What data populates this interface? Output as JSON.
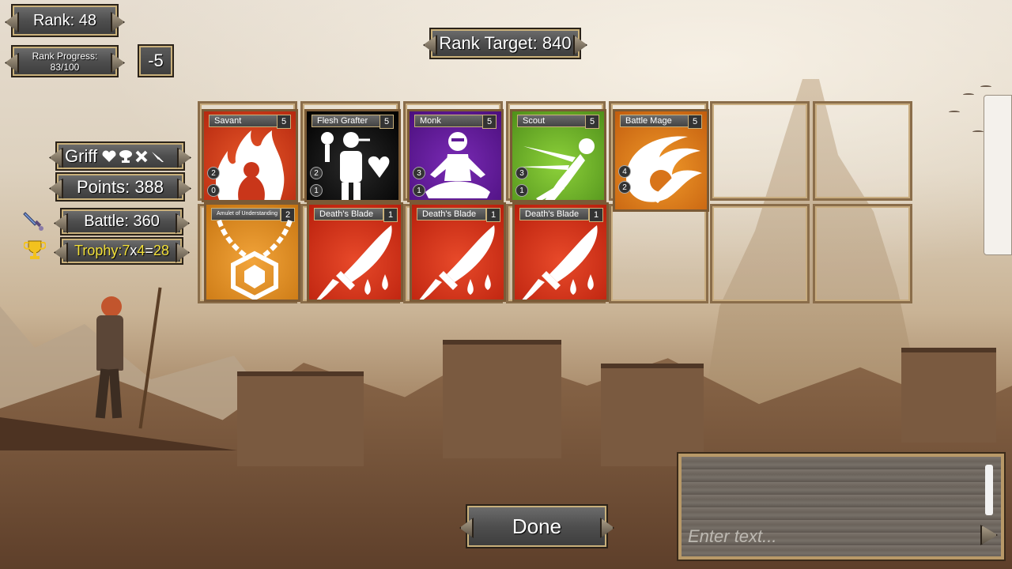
{
  "hud": {
    "rank": "Rank: 48",
    "rank_progress_label": "Rank Progress:",
    "rank_progress_value": "83/100",
    "rank_delta": "-5",
    "rank_target": "Rank Target: 840"
  },
  "player": {
    "name": "Griff",
    "icons": [
      "heart-icon",
      "mushroom-cloud-icon",
      "cross-icon",
      "dagger-icon"
    ],
    "points": "Points: 388",
    "battle": "Battle: 360",
    "trophy_label": "Trophy: ",
    "trophy_a": "7",
    "trophy_x": "x",
    "trophy_b": "4",
    "trophy_eq": "=",
    "trophy_total": "28"
  },
  "heroes": [
    {
      "name": "Savant",
      "level": "5",
      "stats": [
        "2",
        "0"
      ],
      "color": "#c9361a",
      "icon": "fire-person-icon"
    },
    {
      "name": "Flesh Grafter",
      "level": "5",
      "stats": [
        "2",
        "1"
      ],
      "color": "#111111",
      "icon": "flesh-grafter-icon"
    },
    {
      "name": "Monk",
      "level": "5",
      "stats": [
        "3",
        "1"
      ],
      "color": "#5e1a95",
      "icon": "meditating-monk-icon"
    },
    {
      "name": "Scout",
      "level": "5",
      "stats": [
        "3",
        "1"
      ],
      "color": "#6aae25",
      "icon": "running-scout-icon"
    },
    {
      "name": "Battle Mage",
      "level": "5",
      "stats": [
        "4",
        "2"
      ],
      "color": "#d8741a",
      "icon": "fireball-mage-icon"
    }
  ],
  "items": [
    {
      "name": "Amulet of Understanding",
      "count": "2",
      "color": "#e08a22",
      "icon": "amulet-icon"
    },
    {
      "name": "Death's Blade",
      "count": "1",
      "color": "#cf3116",
      "icon": "bleeding-blade-icon"
    },
    {
      "name": "Death's Blade",
      "count": "1",
      "color": "#cf3116",
      "icon": "bleeding-blade-icon"
    },
    {
      "name": "Death's Blade",
      "count": "1",
      "color": "#cf3116",
      "icon": "bleeding-blade-icon"
    }
  ],
  "controls": {
    "done_label": "Done",
    "chat_placeholder": "Enter text..."
  }
}
